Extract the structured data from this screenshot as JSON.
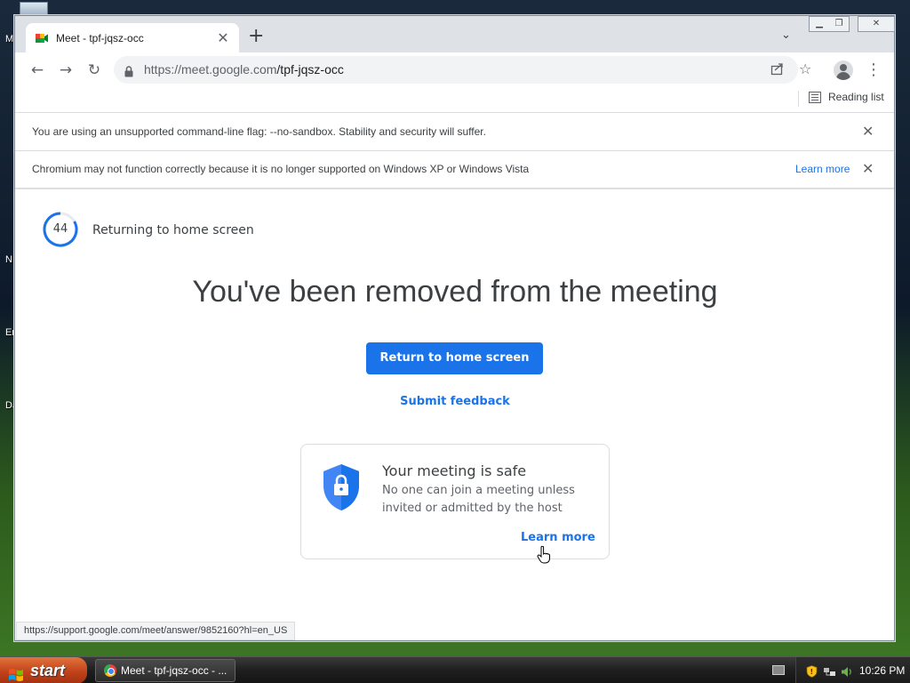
{
  "desktop": {
    "labels": [
      "M",
      "N",
      "Er",
      "Da"
    ]
  },
  "browser": {
    "tab_title": "Meet - tpf-jqsz-occ",
    "url_host": "https://meet.google.com",
    "url_path": "/tpf-jqsz-occ",
    "reading_list": "Reading list",
    "infobars": [
      {
        "message": "You are using an unsupported command-line flag: --no-sandbox. Stability and security will suffer."
      },
      {
        "message": "Chromium may not function correctly because it is no longer supported on Windows XP or Windows Vista",
        "link": "Learn more"
      }
    ],
    "status_url": "https://support.google.com/meet/answer/9852160?hl=en_US"
  },
  "page": {
    "countdown": "44",
    "countdown_label": "Returning to home screen",
    "headline": "You've been removed from the meeting",
    "primary_button": "Return to home screen",
    "feedback_link": "Submit feedback",
    "card": {
      "title": "Your meeting is safe",
      "body": "No one can join a meeting unless invited or admitted by the host",
      "link": "Learn more"
    }
  },
  "taskbar": {
    "start_label": "start",
    "task_button": "Meet - tpf-jqsz-occ - ...",
    "clock": "10:26 PM"
  },
  "colors": {
    "accent": "#1a73e8",
    "text": "#3c4043",
    "start": "#c1421b"
  }
}
